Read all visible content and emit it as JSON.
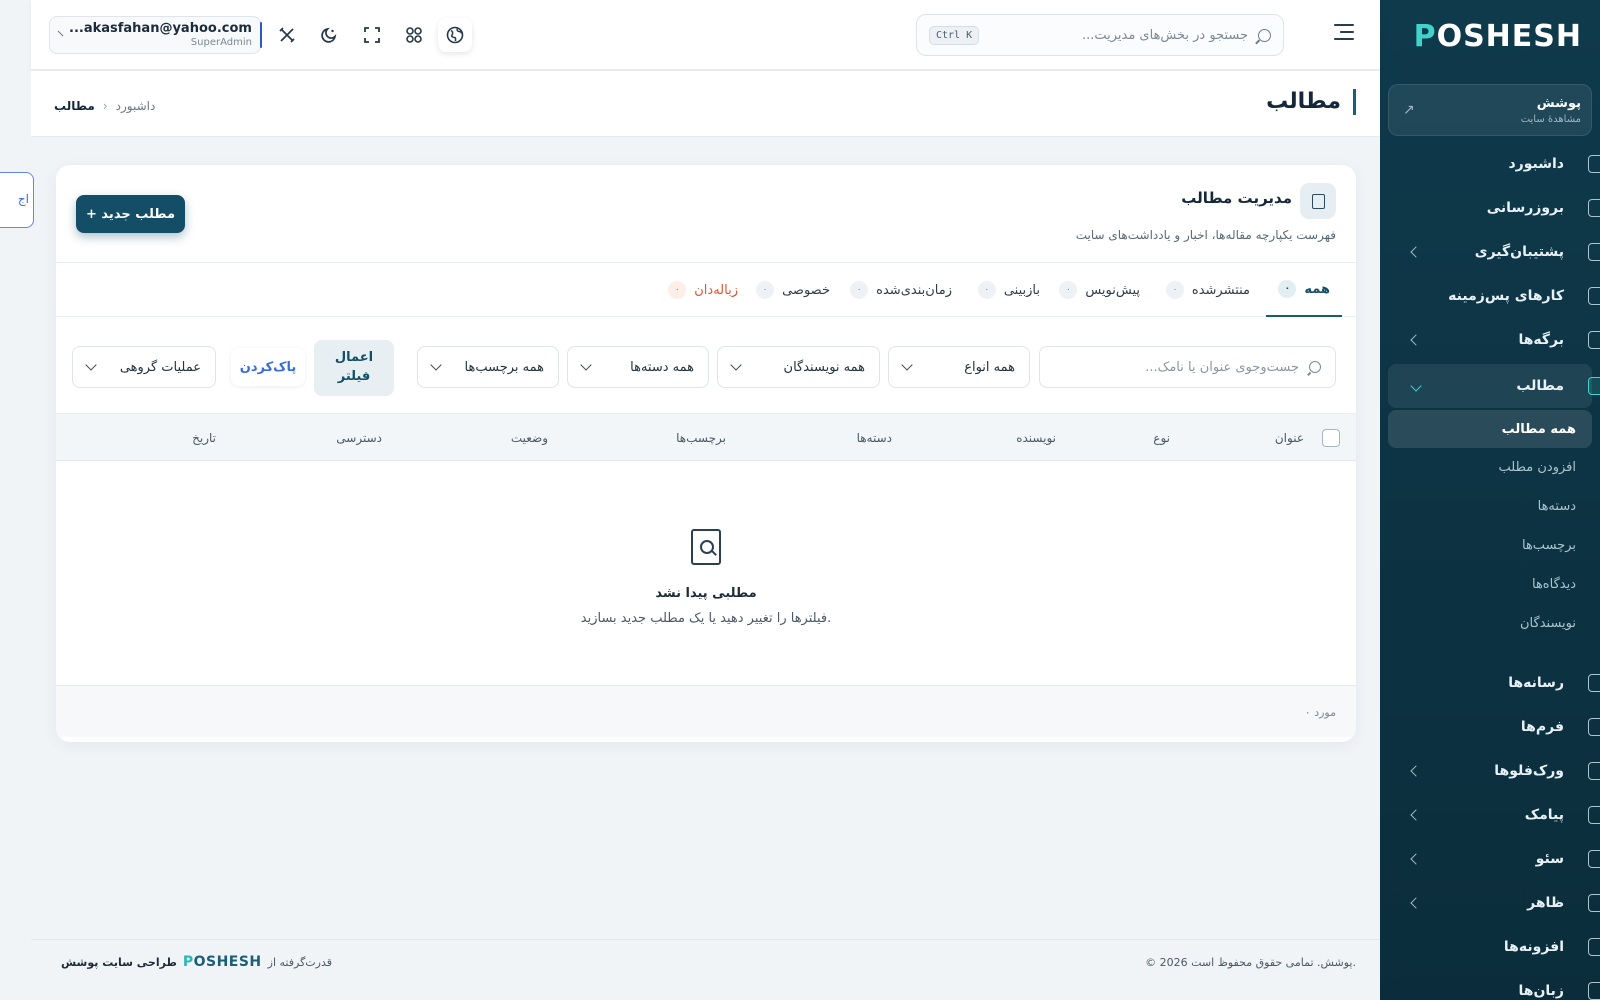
{
  "brand": {
    "logo_first": "P",
    "logo_rest": "OSHESH"
  },
  "site_card": {
    "title": "پوشش",
    "subtitle": "مشاهدهٔ سایت"
  },
  "sidebar": {
    "items": [
      {
        "label": "داشبورد"
      },
      {
        "label": "بروزرسانی"
      },
      {
        "label": "پشتیبان‌گیری"
      },
      {
        "label": "کارهای پس‌زمینه"
      },
      {
        "label": "برگه‌ها"
      },
      {
        "label": "مطالب"
      },
      {
        "label": "رسانه‌ها"
      },
      {
        "label": "فرم‌ها"
      },
      {
        "label": "ورک‌فلوها"
      },
      {
        "label": "پیامک"
      },
      {
        "label": "سئو"
      },
      {
        "label": "ظاهر"
      },
      {
        "label": "افزونه‌ها"
      },
      {
        "label": "زبان‌ها"
      }
    ],
    "sub_items": [
      {
        "label": "همه مطالب"
      },
      {
        "label": "افزودن مطلب"
      },
      {
        "label": "دسته‌ها"
      },
      {
        "label": "برچسب‌ها"
      },
      {
        "label": "دیدگاه‌ها"
      },
      {
        "label": "نویسندگان"
      }
    ]
  },
  "topbar": {
    "search_placeholder": "جستجو در بخش‌های مدیریت...",
    "shortcut": "Ctrl K",
    "user_email": "...akasfahan@yahoo.com",
    "user_role": "SuperAdmin"
  },
  "page": {
    "title": "مطالب",
    "breadcrumb": {
      "current": "مطالب",
      "separator": "›",
      "parent": "داشبورد"
    }
  },
  "card": {
    "title": "مدیریت مطالب",
    "subtitle": "فهرست یکپارچه مقاله‌ها، اخبار و یادداشت‌های سایت",
    "new_button": "+ مطلب جدید"
  },
  "tabs": [
    {
      "label": "همه",
      "count": "۰"
    },
    {
      "label": "منتشرشده",
      "count": "۰"
    },
    {
      "label": "پیش‌نویس",
      "count": "۰"
    },
    {
      "label": "بازبینی",
      "count": "۰"
    },
    {
      "label": "زمان‌بندی‌شده",
      "count": "۰"
    },
    {
      "label": "خصوصی",
      "count": "۰"
    },
    {
      "label": "زباله‌دان",
      "count": "۰"
    }
  ],
  "filters": {
    "search_placeholder": "جست‌وجوی عنوان یا نامک...",
    "type": "همه انواع",
    "author": "همه نویسندگان",
    "category": "همه دسته‌ها",
    "tag": "همه برچسب‌ها",
    "apply_line1": "اعمال",
    "apply_line2": "فیلتر",
    "clear": "پاک‌کردن",
    "bulk": "عملیات گروهی",
    "peek_text": "اج"
  },
  "table": {
    "columns": [
      "عنوان",
      "نوع",
      "نویسنده",
      "دسته‌ها",
      "برچسب‌ها",
      "وضعیت",
      "دسترسی",
      "تاریخ"
    ]
  },
  "empty": {
    "title": "مطلبی پیدا نشد",
    "subtitle": "فیلترها را تغییر دهید یا یک مطلب جدید بسازید."
  },
  "card_footer": {
    "count": "۰ مورد"
  },
  "footer": {
    "copyright": "© 2026 پوشش. تمامی حقوق محفوظ است.",
    "powered_by": "قدرت‌گرفته از",
    "credit_label": "طراحی سایت پوشش"
  },
  "colors": {
    "sidebar": "#0f3a4c",
    "accent": "#134e66",
    "teal": "#3fd3cc",
    "trash": "#e0542f",
    "link": "#3b6be0"
  },
  "icons": [
    "menu-icon",
    "search-icon",
    "globe-icon",
    "apps-icon",
    "fullscreen-icon",
    "theme-icon",
    "tools-icon",
    "external-link-icon",
    "document-icon",
    "file-search-icon"
  ]
}
